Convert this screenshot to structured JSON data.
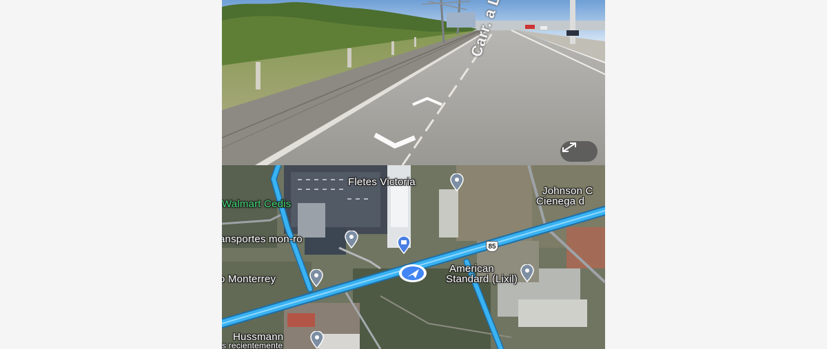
{
  "street_view": {
    "road_label": "Carr. a Laredo",
    "expand_icon": "expand-arrows-icon"
  },
  "map": {
    "places": [
      {
        "name": "Fletes Victoria",
        "style": "white"
      },
      {
        "name": "Johnson C",
        "style": "white"
      },
      {
        "name": "Cienega d",
        "style": "white"
      },
      {
        "name": "Walmart Cedis",
        "style": "green"
      },
      {
        "name": "ansportes mon-ro",
        "style": "white"
      },
      {
        "name": "American",
        "style": "white"
      },
      {
        "name": "Standard (Lixil)",
        "style": "white"
      },
      {
        "name": "o Monterrey",
        "style": "white"
      },
      {
        "name": "Hussmann",
        "style": "white"
      },
      {
        "name": "s recientemente",
        "style": "white"
      }
    ],
    "route_number": "85",
    "colors": {
      "route": "#32a8ea",
      "marker": "#4285f4",
      "pin": "#7d8ea3"
    }
  }
}
